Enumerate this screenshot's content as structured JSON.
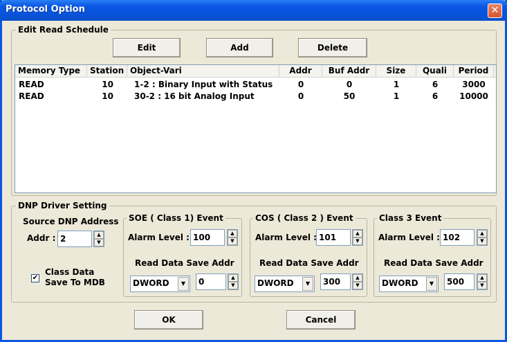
{
  "window": {
    "title": "Protocol Option",
    "close_glyph": "✕"
  },
  "edit_schedule": {
    "label": "Edit Read Schedule",
    "buttons": {
      "edit": "Edit",
      "add": "Add",
      "delete": "Delete"
    },
    "columns": [
      "Memory Type",
      "Station",
      "Object-Vari",
      "Addr",
      "Buf Addr",
      "Size",
      "Quali",
      "Period"
    ],
    "rows": [
      [
        "READ",
        "10",
        "1-2 : Binary Input with Status",
        "0",
        "0",
        "1",
        "6",
        "3000"
      ],
      [
        "READ",
        "10",
        "30-2 : 16 bit Analog Input",
        "0",
        "50",
        "1",
        "6",
        "10000"
      ]
    ]
  },
  "dnp": {
    "label": "DNP Driver Setting",
    "source_label": "Source DNP Address",
    "addr_label": "Addr :",
    "addr_value": "2",
    "class_data_line1": "Class Data",
    "class_data_line2": "Save To MDB",
    "class_data_checked": "✔",
    "soe": {
      "label": "SOE ( Class 1) Event",
      "alarm_label": "Alarm Level :",
      "alarm_value": "100",
      "save_label": "Read Data Save Addr",
      "type_value": "DWORD",
      "addr_value": "0"
    },
    "cos": {
      "label": "COS ( Class 2 )  Event",
      "alarm_label": "Alarm Level :",
      "alarm_value": "101",
      "save_label": "Read Data Save Addr",
      "type_value": "DWORD",
      "addr_value": "300"
    },
    "class3": {
      "label": "Class 3  Event",
      "alarm_label": "Alarm Level :",
      "alarm_value": "102",
      "save_label": "Read Data Save Addr",
      "type_value": "DWORD",
      "addr_value": "500"
    }
  },
  "footer": {
    "ok": "OK",
    "cancel": "Cancel"
  },
  "icons": {
    "spin_up": "▲",
    "spin_down": "▼",
    "dropdown": "▼"
  }
}
